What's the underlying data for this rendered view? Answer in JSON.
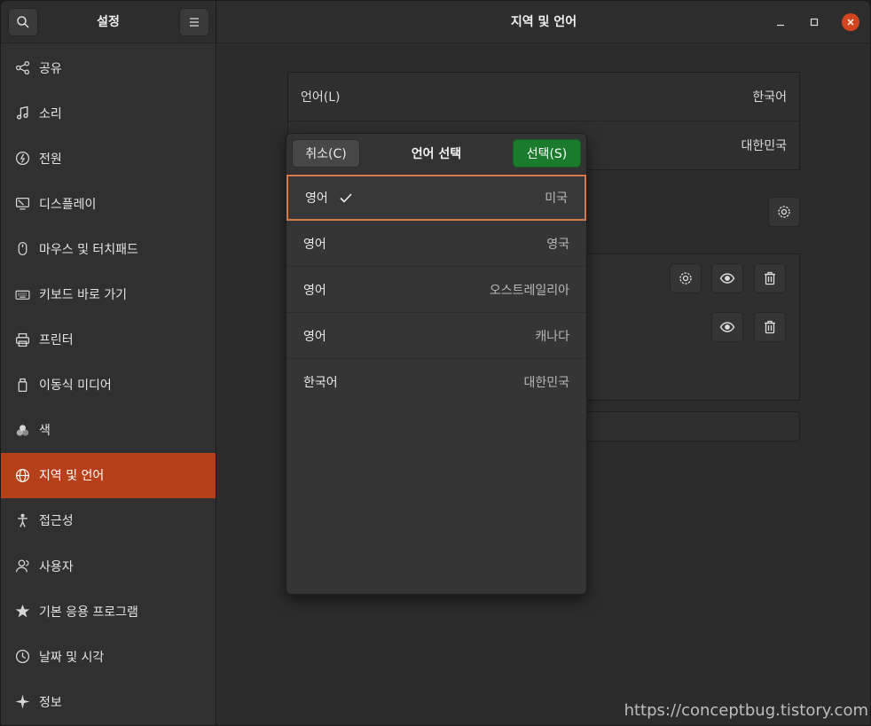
{
  "sidebar": {
    "title": "설정",
    "search_icon": "search-icon",
    "menu_icon": "hamburger-icon",
    "items": [
      {
        "label": "공유",
        "icon": "share-icon"
      },
      {
        "label": "소리",
        "icon": "music-note-icon"
      },
      {
        "label": "전원",
        "icon": "power-icon"
      },
      {
        "label": "디스플레이",
        "icon": "display-icon"
      },
      {
        "label": "마우스 및 터치패드",
        "icon": "mouse-icon"
      },
      {
        "label": "키보드 바로 가기",
        "icon": "keyboard-icon"
      },
      {
        "label": "프린터",
        "icon": "printer-icon"
      },
      {
        "label": "이동식 미디어",
        "icon": "usb-drive-icon"
      },
      {
        "label": "색",
        "icon": "color-icon"
      },
      {
        "label": "지역 및 언어",
        "icon": "globe-icon",
        "active": true
      },
      {
        "label": "접근성",
        "icon": "accessibility-icon"
      },
      {
        "label": "사용자",
        "icon": "users-icon"
      },
      {
        "label": "기본 응용 프로그램",
        "icon": "star-icon"
      },
      {
        "label": "날짜 및 시각",
        "icon": "clock-icon"
      },
      {
        "label": "정보",
        "icon": "sparkle-icon"
      }
    ]
  },
  "main": {
    "title": "지역 및 언어",
    "language_row": {
      "label": "언어(L)",
      "value": "한국어"
    },
    "format_row": {
      "value": "대한민국"
    }
  },
  "dialog": {
    "title": "언어 선택",
    "cancel_label": "취소(C)",
    "select_label": "선택(S)",
    "languages": [
      {
        "name": "영어",
        "region": "미국",
        "selected": true
      },
      {
        "name": "영어",
        "region": "영국"
      },
      {
        "name": "영어",
        "region": "오스트레일리아"
      },
      {
        "name": "영어",
        "region": "캐나다"
      },
      {
        "name": "한국어",
        "region": "대한민국"
      }
    ]
  },
  "watermark": "https://conceptbug.tistory.com",
  "colors": {
    "accent": "#b5401a",
    "select_button": "#1b7b2c",
    "close_button": "#d2451e",
    "selection_border": "#d57a4a"
  }
}
